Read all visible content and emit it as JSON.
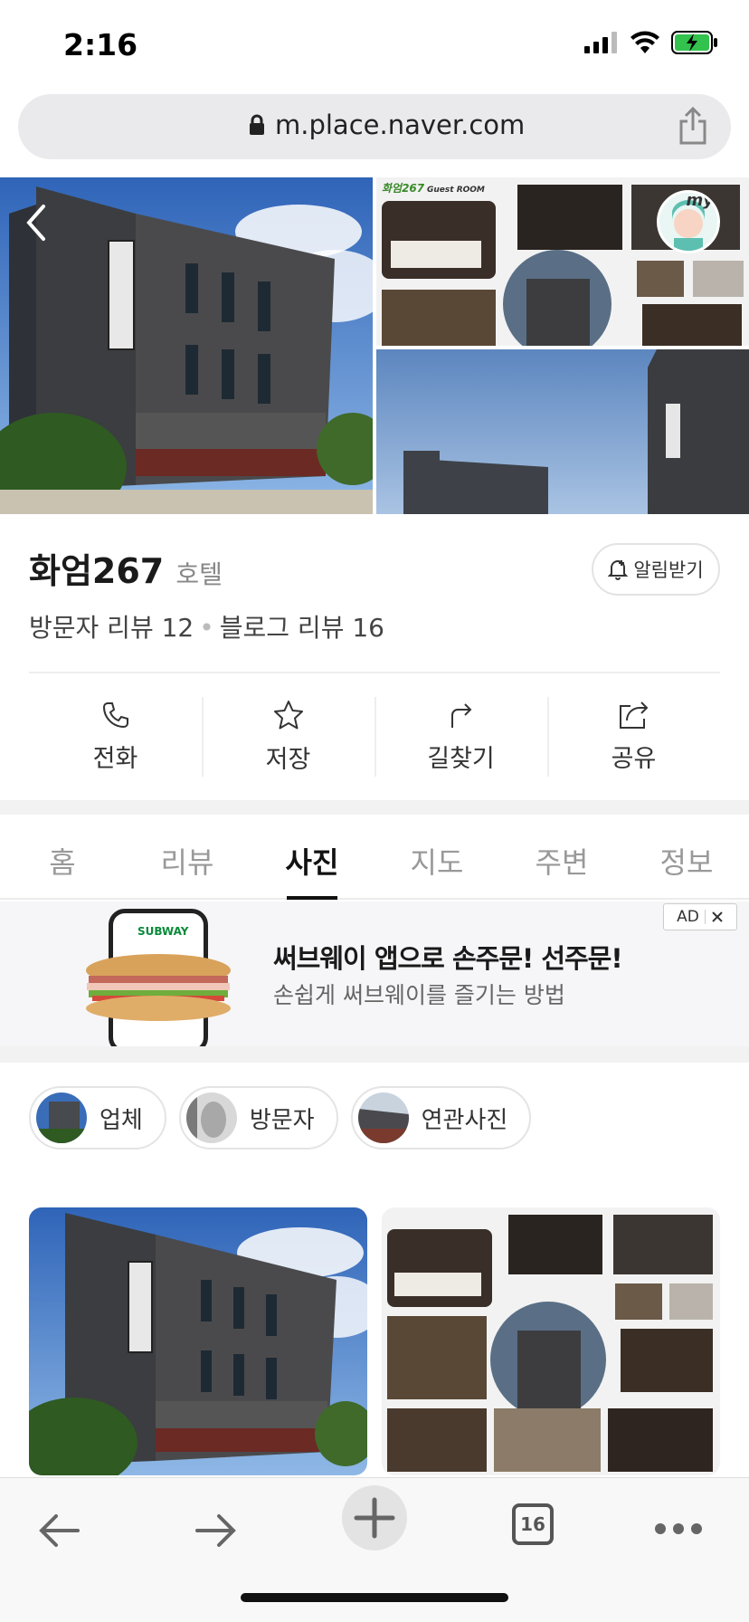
{
  "status": {
    "time": "2:16"
  },
  "browser": {
    "url": "m.place.naver.com",
    "tab_count": "16"
  },
  "hero": {
    "collage_title": "화엄267",
    "collage_sub": "Guest ROOM",
    "my_badge": "my"
  },
  "place": {
    "name": "화엄267",
    "category": "호텔",
    "notify_label": "알림받기",
    "visitor_reviews": "방문자 리뷰 12",
    "blog_reviews": "블로그 리뷰 16"
  },
  "actions": [
    {
      "label": "전화",
      "icon": "phone-icon"
    },
    {
      "label": "저장",
      "icon": "star-icon"
    },
    {
      "label": "길찾기",
      "icon": "directions-icon"
    },
    {
      "label": "공유",
      "icon": "share-icon"
    }
  ],
  "tabs": [
    {
      "label": "홈"
    },
    {
      "label": "리뷰"
    },
    {
      "label": "사진",
      "active": true
    },
    {
      "label": "지도"
    },
    {
      "label": "주변"
    },
    {
      "label": "정보"
    }
  ],
  "ad": {
    "headline": "써브웨이 앱으로 손주문! 선주문!",
    "subtext": "손쉽게 써브웨이를 즐기는 방법",
    "tag": "AD",
    "brand": "SUBWAY"
  },
  "photo_filters": [
    {
      "label": "업체"
    },
    {
      "label": "방문자"
    },
    {
      "label": "연관사진"
    }
  ],
  "colors": {
    "accent_green": "#03c75a",
    "active_tab": "#111111",
    "muted": "#999999"
  }
}
